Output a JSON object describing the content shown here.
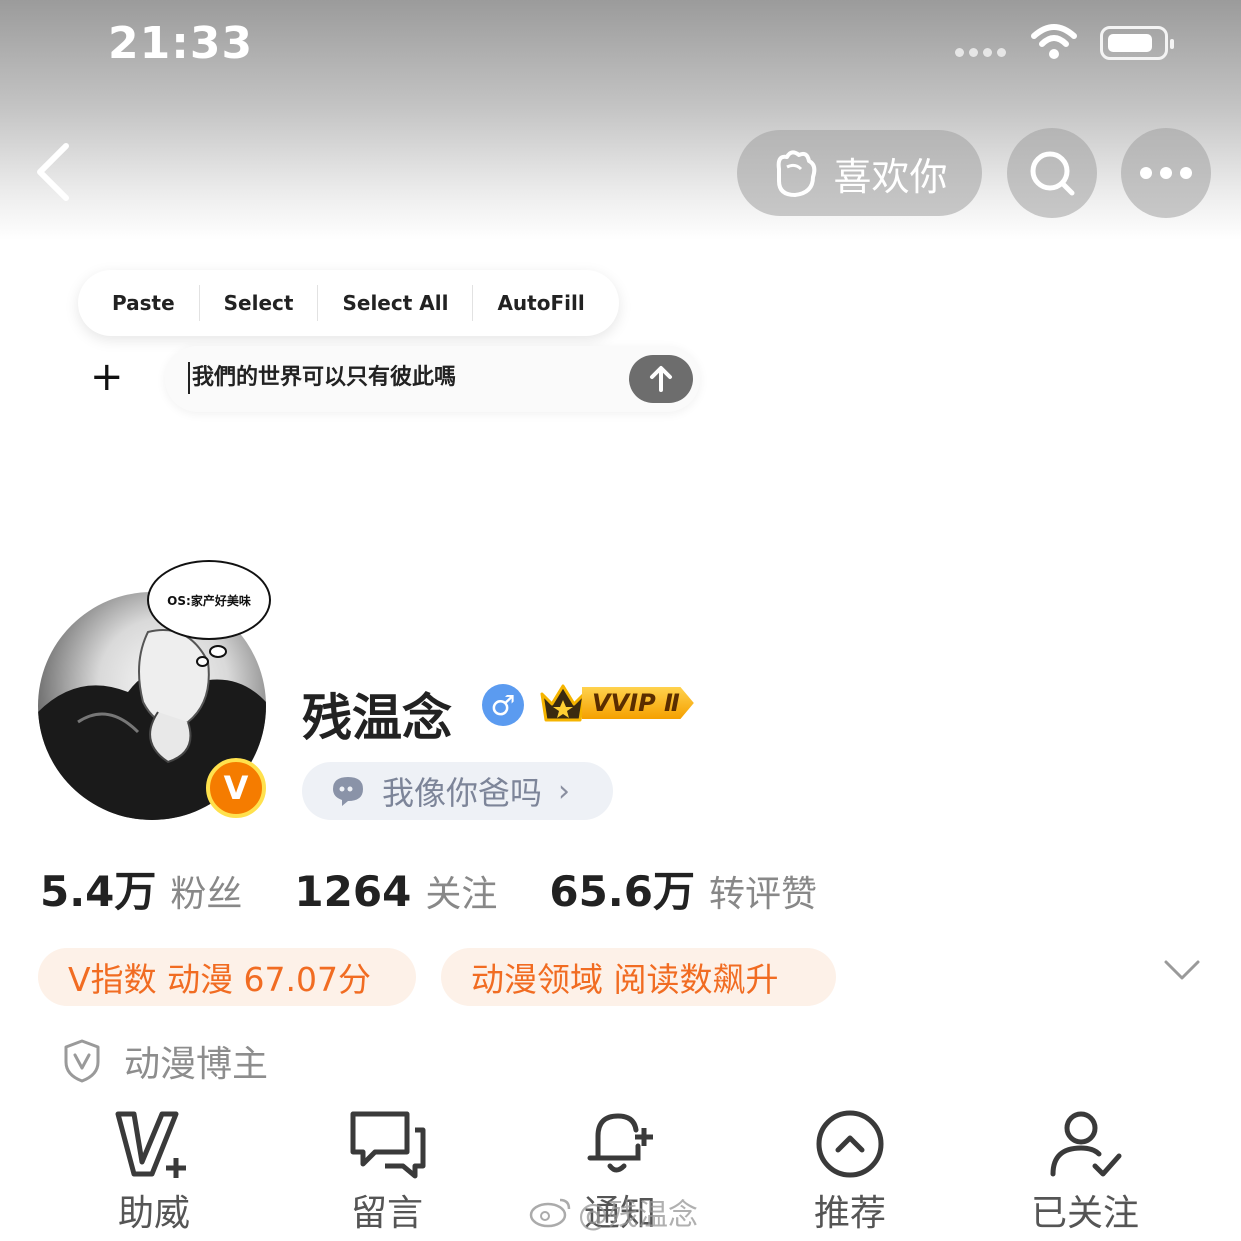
{
  "status_bar": {
    "time": "21:33"
  },
  "header": {
    "like_button_label": "喜欢你"
  },
  "embedded_chat": {
    "menu_items": [
      "Paste",
      "Select",
      "Select All",
      "AutoFill"
    ],
    "input_text": "我們的世界可以只有彼此嗎"
  },
  "profile": {
    "avatar_bubble_text": "OS:家产好美味",
    "badge_letter": "V",
    "username": "残温念",
    "gender_symbol": "♂",
    "vip_label": "VVIP Ⅱ",
    "motto": "我像你爸吗",
    "motto_arrow": "›"
  },
  "stats": [
    {
      "value": "5.4万",
      "label": "粉丝"
    },
    {
      "value": "1264",
      "label": "关注"
    },
    {
      "value": "65.6万",
      "label": "转评赞"
    }
  ],
  "tags": [
    "V指数 动漫 67.07分",
    "动漫领域 阅读数飙升"
  ],
  "verification": {
    "text": "动漫博主"
  },
  "actions": [
    {
      "label": "助威",
      "icon": "v-plus-icon"
    },
    {
      "label": "留言",
      "icon": "message-icon"
    },
    {
      "label": "通知",
      "icon": "bell-plus-icon"
    },
    {
      "label": "推荐",
      "icon": "up-circle-icon"
    },
    {
      "label": "已关注",
      "icon": "user-check-icon"
    }
  ],
  "watermark": "@残温念",
  "colors": {
    "accent_orange": "#f16c22",
    "tag_bg": "#fdf1e8",
    "gender_blue": "#5b9bf0"
  }
}
